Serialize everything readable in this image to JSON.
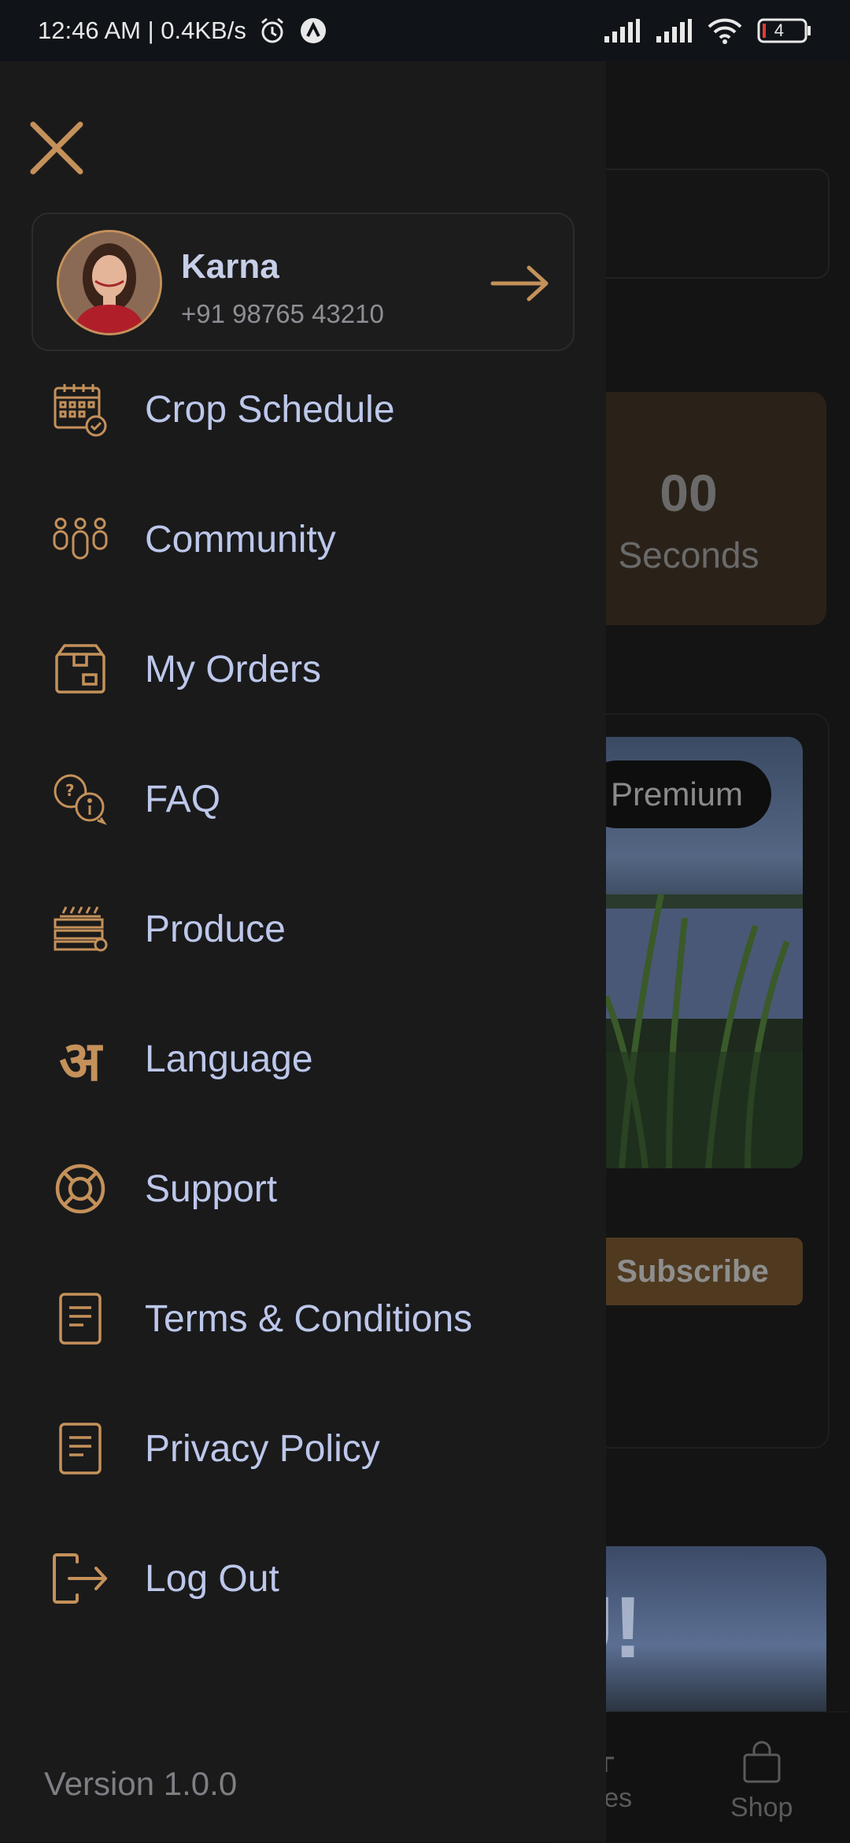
{
  "status_bar": {
    "time_speed": "12:46 AM | 0.4KB/s",
    "battery": "4"
  },
  "background": {
    "timer_value": "00",
    "timer_label": "Seconds",
    "premium_badge": "Premium",
    "subscribe_button": "Subscribe",
    "nav_courses": "urses",
    "nav_shop": "Shop"
  },
  "profile": {
    "name": "Karna",
    "phone": "+91 98765 43210"
  },
  "menu": [
    {
      "label": "Crop Schedule",
      "icon": "calendar-check-icon"
    },
    {
      "label": "Community",
      "icon": "community-icon"
    },
    {
      "label": "My Orders",
      "icon": "package-icon"
    },
    {
      "label": "FAQ",
      "icon": "faq-bubbles-icon"
    },
    {
      "label": "Produce",
      "icon": "produce-crate-icon"
    },
    {
      "label": "Language",
      "icon": "hindi-letter-icon"
    },
    {
      "label": "Support",
      "icon": "lifebuoy-icon"
    },
    {
      "label": "Terms & Conditions",
      "icon": "document-icon"
    },
    {
      "label": "Privacy Policy",
      "icon": "document-icon"
    },
    {
      "label": "Log Out",
      "icon": "logout-icon"
    }
  ],
  "version": "Version 1.0.0",
  "colors": {
    "accent": "#c4915a",
    "menu_text": "#bcc7ea",
    "drawer_bg": "#1a1a1b"
  }
}
